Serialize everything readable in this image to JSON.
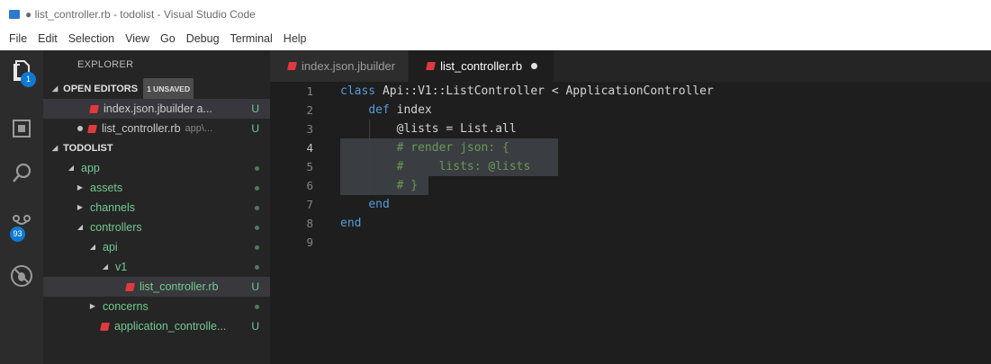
{
  "window": {
    "title": "● list_controller.rb - todolist - Visual Studio Code"
  },
  "menu": [
    "File",
    "Edit",
    "Selection",
    "View",
    "Go",
    "Debug",
    "Terminal",
    "Help"
  ],
  "activity": {
    "explorer_badge": "1",
    "scm_badge": "93"
  },
  "sidebar": {
    "header": "EXPLORER",
    "open_editors": {
      "label": "OPEN EDITORS",
      "badge": "1 UNSAVED",
      "items": [
        {
          "label": "index.json.jbuilder  a...",
          "status": "U"
        },
        {
          "label": "list_controller.rb",
          "path": "app\\...",
          "status": "U"
        }
      ]
    },
    "project": {
      "label": "TODOLIST",
      "tree": [
        {
          "label": "app"
        },
        {
          "label": "assets"
        },
        {
          "label": "channels"
        },
        {
          "label": "controllers"
        },
        {
          "label": "api"
        },
        {
          "label": "v1"
        },
        {
          "label": "list_controller.rb",
          "status": "U"
        },
        {
          "label": "concerns"
        },
        {
          "label": "application_controlle...",
          "status": "U"
        }
      ]
    }
  },
  "tabs": [
    {
      "label": "index.json.jbuilder"
    },
    {
      "label": "list_controller.rb"
    }
  ],
  "code": {
    "lines": [
      {
        "n": "1",
        "parts": [
          [
            "kw",
            "class "
          ],
          [
            "cls",
            "Api::V1::ListController < ApplicationController"
          ]
        ]
      },
      {
        "n": "2",
        "parts": [
          [
            "sp",
            "    "
          ],
          [
            "kw",
            "def "
          ],
          [
            "cls",
            "index"
          ]
        ]
      },
      {
        "n": "3",
        "parts": [
          [
            "sp",
            "        "
          ],
          [
            "cls",
            "@lists = List.all"
          ]
        ]
      },
      {
        "n": "4",
        "parts": [
          [
            "sp",
            "        "
          ],
          [
            "cm",
            "# render json: {"
          ]
        ]
      },
      {
        "n": "5",
        "parts": [
          [
            "sp",
            "        "
          ],
          [
            "cm",
            "#     lists: @lists"
          ]
        ]
      },
      {
        "n": "6",
        "parts": [
          [
            "sp",
            "        "
          ],
          [
            "cm",
            "# }"
          ]
        ]
      },
      {
        "n": "7",
        "parts": [
          [
            "sp",
            "    "
          ],
          [
            "kw",
            "end"
          ]
        ]
      },
      {
        "n": "8",
        "parts": [
          [
            "kw",
            "end"
          ]
        ]
      },
      {
        "n": "9",
        "parts": []
      }
    ]
  }
}
